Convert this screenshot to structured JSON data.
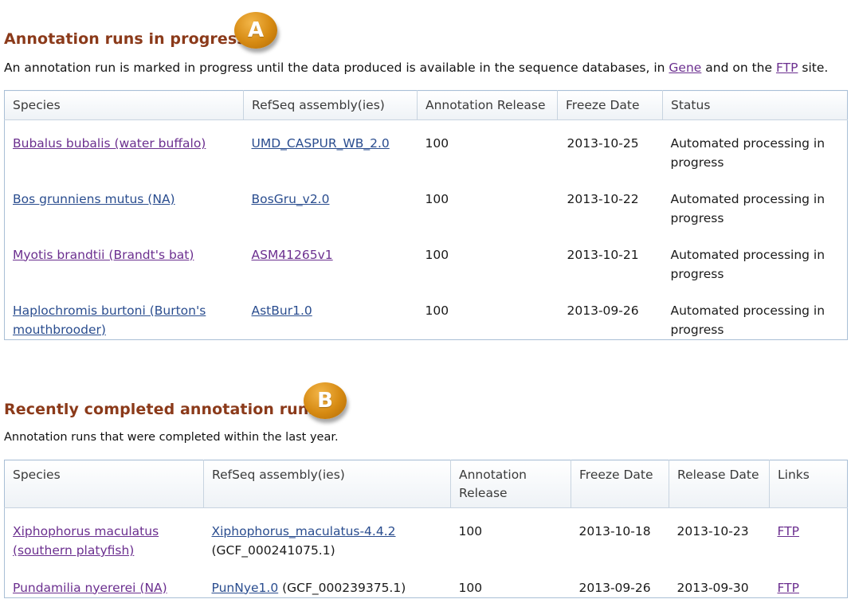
{
  "in_progress": {
    "title": "Annotation runs in progress",
    "badge": "A",
    "desc_before_gene": "An annotation run is marked in progress until the data produced is available in the sequence databases, in ",
    "gene_link": "Gene",
    "desc_between": " and on the ",
    "ftp_link": "FTP",
    "desc_after": " site.",
    "headers": [
      "Species",
      "RefSeq assembly(ies)",
      "Annotation Release",
      "Freeze Date",
      "Status"
    ],
    "rows": [
      {
        "species": "Bubalus bubalis (water buffalo)",
        "assembly": "UMD_CASPUR_WB_2.0",
        "release": "100",
        "freeze": "2013-10-25",
        "status": "Automated processing in progress"
      },
      {
        "species": "Bos grunniens mutus (NA)",
        "assembly": "BosGru_v2.0",
        "release": "100",
        "freeze": "2013-10-22",
        "status": "Automated processing in progress"
      },
      {
        "species": "Myotis brandtii (Brandt's bat)",
        "assembly": "ASM41265v1",
        "release": "100",
        "freeze": "2013-10-21",
        "status": "Automated processing in progress"
      },
      {
        "species": "Haplochromis burtoni (Burton's mouthbrooder)",
        "assembly": "AstBur1.0",
        "release": "100",
        "freeze": "2013-09-26",
        "status": "Automated processing in progress"
      }
    ]
  },
  "completed": {
    "title": "Recently completed annotation runs",
    "badge": "B",
    "desc": "Annotation runs that were completed within the last year.",
    "headers": [
      "Species",
      "RefSeq assembly(ies)",
      "Annotation Release",
      "Freeze Date",
      "Release Date",
      "Links"
    ],
    "rows": [
      {
        "species": "Xiphophorus maculatus (southern platyfish)",
        "assembly": "Xiphophorus_maculatus-4.4.2",
        "accession": "(GCF_000241075.1)",
        "release": "100",
        "freeze": "2013-10-18",
        "release_date": "2013-10-23",
        "link": "FTP"
      },
      {
        "species": "Pundamilia nyererei (NA)",
        "assembly": "PunNye1.0",
        "accession": "(GCF_000239375.1)",
        "release": "100",
        "freeze": "2013-09-26",
        "release_date": "2013-09-30",
        "link": "FTP"
      }
    ]
  }
}
